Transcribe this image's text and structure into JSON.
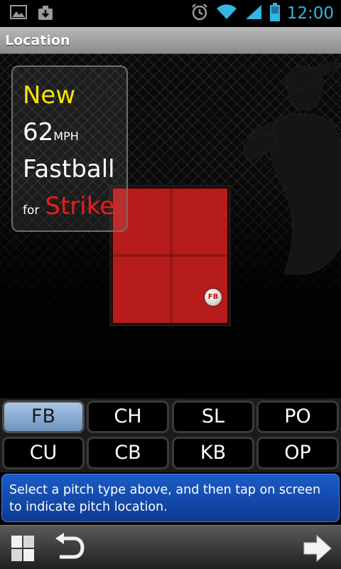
{
  "status_bar": {
    "time": "12:00",
    "icons": [
      "gallery-icon",
      "download-icon",
      "alarm-icon",
      "wifi-icon",
      "signal-icon",
      "battery-icon"
    ]
  },
  "title_bar": {
    "title": "Location"
  },
  "pitch_info": {
    "status": "New",
    "speed": "62",
    "speed_unit": "MPH",
    "pitch_type": "Fastball",
    "result_prefix": "for",
    "result": "Strike"
  },
  "pitch_marker": {
    "label": "FB"
  },
  "pitch_buttons": [
    {
      "label": "FB",
      "selected": true
    },
    {
      "label": "CH",
      "selected": false
    },
    {
      "label": "SL",
      "selected": false
    },
    {
      "label": "PO",
      "selected": false
    },
    {
      "label": "CU",
      "selected": false
    },
    {
      "label": "CB",
      "selected": false
    },
    {
      "label": "KB",
      "selected": false
    },
    {
      "label": "OP",
      "selected": false
    }
  ],
  "instruction": "Select a pitch type above, and then tap on screen to indicate pitch location.",
  "bottom_bar": {
    "left_icons": [
      "grid-icon",
      "undo-icon"
    ],
    "right_icons": [
      "next-arrow-icon"
    ]
  },
  "colors": {
    "accent_blue": "#33b5e5",
    "status_yellow": "#f7e600",
    "strike_red": "#f01a1a",
    "zone_red": "#b71c1c",
    "instruction_blue": "#1b5cc8"
  }
}
